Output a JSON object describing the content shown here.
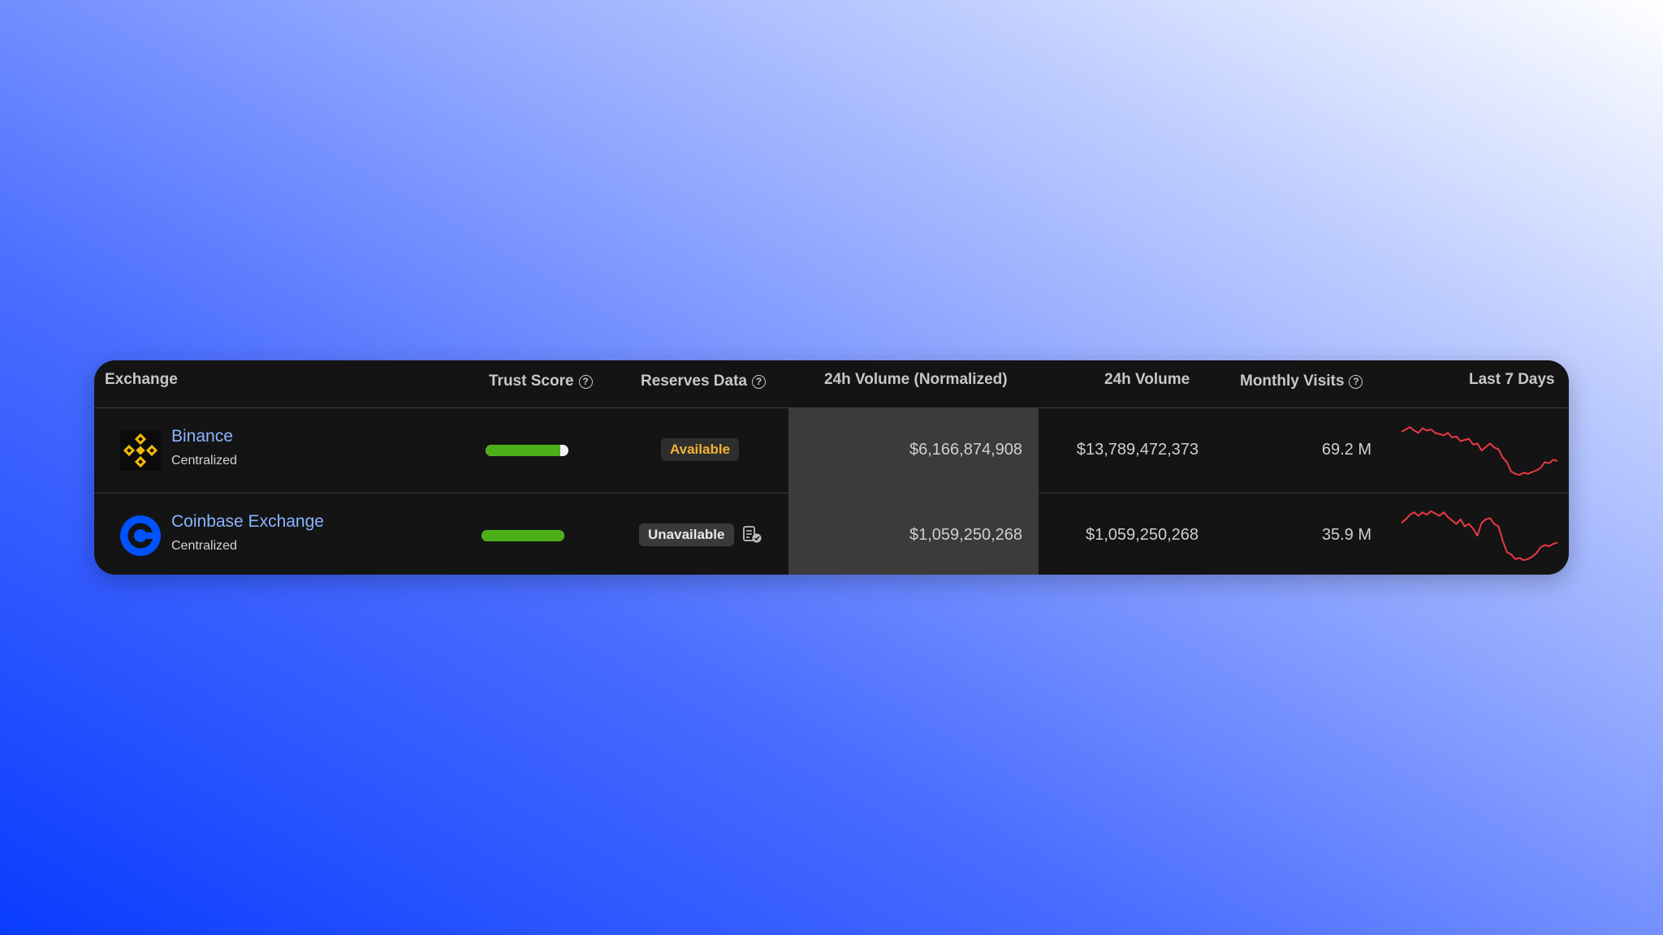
{
  "table": {
    "columns": [
      {
        "label": "Exchange"
      },
      {
        "label": "Trust Score",
        "help": true
      },
      {
        "label": "Reserves Data",
        "help": true
      },
      {
        "label": "24h Volume (Normalized)"
      },
      {
        "label": "24h Volume"
      },
      {
        "label": "Monthly Visits",
        "help": true
      },
      {
        "label": "Last 7 Days"
      }
    ],
    "help_glyph": "?",
    "rows": [
      {
        "name": "Binance",
        "type": "Centralized",
        "logo_icon": "binance-logo",
        "brand_color": "#f0b90b",
        "trust_score": "9",
        "trust_fraction": 0.9,
        "reserves": "Available",
        "volume_normalized": "$6,166,874,908",
        "volume": "$13,789,472,373",
        "monthly_visits": "69.2 M",
        "sparkline": [
          0.82,
          0.86,
          0.9,
          0.84,
          0.8,
          0.88,
          0.84,
          0.86,
          0.8,
          0.78,
          0.76,
          0.8,
          0.72,
          0.74,
          0.66,
          0.68,
          0.7,
          0.6,
          0.62,
          0.5,
          0.56,
          0.62,
          0.55,
          0.52,
          0.38,
          0.3,
          0.14,
          0.1,
          0.08,
          0.12,
          0.1,
          0.13,
          0.16,
          0.2,
          0.3,
          0.28,
          0.34,
          0.32
        ]
      },
      {
        "name": "Coinbase Exchange",
        "type": "Centralized",
        "logo_icon": "coinbase-logo",
        "brand_color": "#0052ff",
        "trust_score": "10",
        "trust_fraction": 1.0,
        "reserves": "Unavailable",
        "reserves_icon": "proof-of-reserves-icon",
        "volume_normalized": "$1,059,250,268",
        "volume": "$1,059,250,268",
        "monthly_visits": "35.9 M",
        "sparkline": [
          0.72,
          0.78,
          0.86,
          0.9,
          0.84,
          0.9,
          0.86,
          0.92,
          0.88,
          0.84,
          0.9,
          0.82,
          0.76,
          0.7,
          0.78,
          0.66,
          0.7,
          0.62,
          0.5,
          0.72,
          0.78,
          0.8,
          0.7,
          0.66,
          0.42,
          0.22,
          0.18,
          0.1,
          0.12,
          0.08,
          0.1,
          0.14,
          0.2,
          0.3,
          0.34,
          0.32,
          0.36,
          0.38
        ]
      }
    ],
    "sparkline_color": "#ea3943"
  }
}
